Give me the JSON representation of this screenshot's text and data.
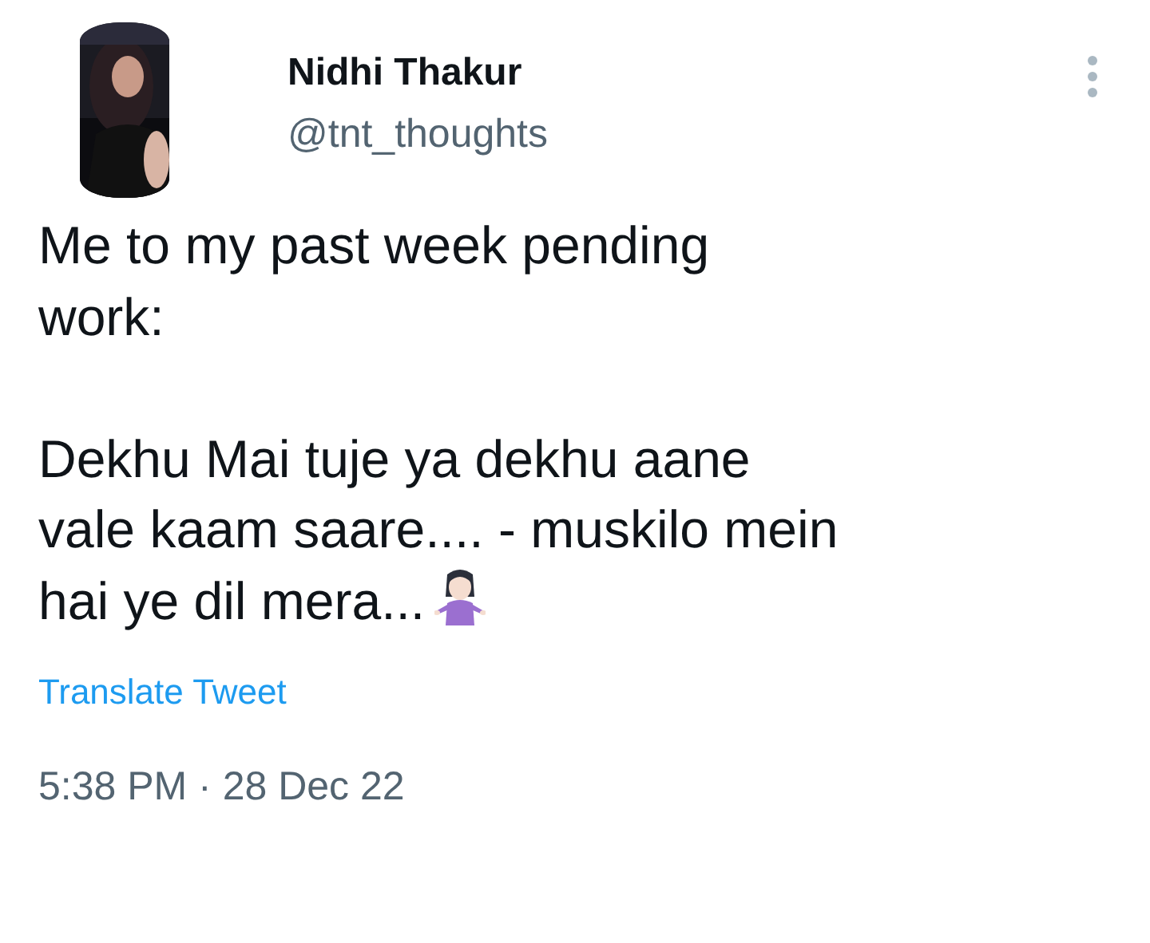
{
  "tweet": {
    "author": {
      "name": "Nidhi Thakur",
      "handle": "@tnt_thoughts"
    },
    "paragraphs": [
      [
        "Me to my past week pending",
        "work:"
      ],
      [
        "Dekhu Mai tuje ya dekhu aane",
        "vale kaam saare.... - muskilo mein",
        "hai ye dil mera..."
      ]
    ],
    "translate_link": "Translate Tweet",
    "timestamp": "5:38 PM · 28 Dec 22"
  }
}
